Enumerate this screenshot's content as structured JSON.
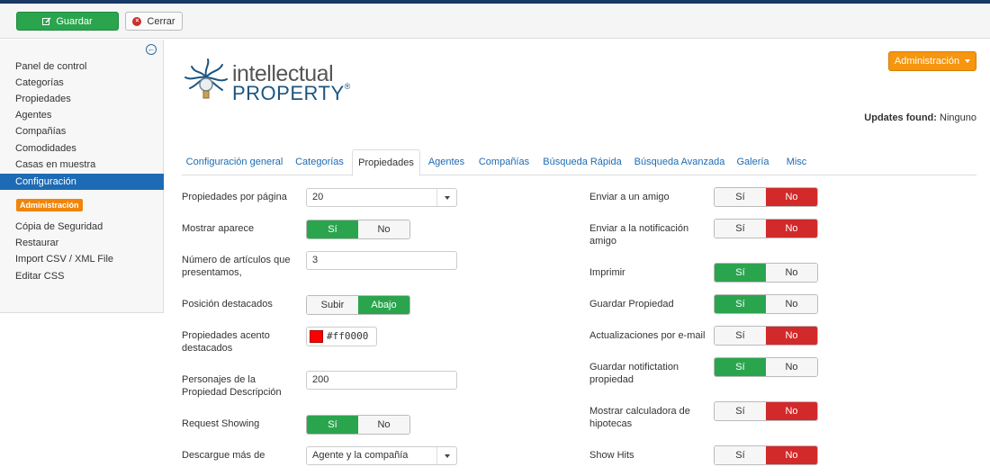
{
  "toolbar": {
    "save_label": "Guardar",
    "close_label": "Cerrar"
  },
  "sidebar": {
    "items": [
      {
        "label": "Panel de control"
      },
      {
        "label": "Categorías"
      },
      {
        "label": "Propiedades"
      },
      {
        "label": "Agentes"
      },
      {
        "label": "Compañías"
      },
      {
        "label": "Comodidades"
      },
      {
        "label": "Casas en muestra"
      },
      {
        "label": "Configuración"
      }
    ],
    "badge": "Administración",
    "tools": [
      {
        "label": "Cópia de Seguridad"
      },
      {
        "label": "Restaurar"
      },
      {
        "label": "Import CSV / XML File"
      },
      {
        "label": "Editar CSS"
      }
    ]
  },
  "logo": {
    "line1": "intellectual",
    "line2": "PROPERTY",
    "mark": "®"
  },
  "header": {
    "admin_button": "Administración",
    "updates_label": "Updates found:",
    "updates_value": "Ninguno"
  },
  "tabs": [
    {
      "label": "Configuración general"
    },
    {
      "label": "Categorías"
    },
    {
      "label": "Propiedades"
    },
    {
      "label": "Agentes"
    },
    {
      "label": "Compañías"
    },
    {
      "label": "Búsqueda Rápida"
    },
    {
      "label": "Búsqueda Avanzada"
    },
    {
      "label": "Galería"
    },
    {
      "label": "Misc"
    }
  ],
  "left_fields": {
    "per_page": {
      "label": "Propiedades por página",
      "value": "20"
    },
    "show_appears": {
      "label": "Mostrar aparece",
      "yes": "Sí",
      "no": "No",
      "selected": "yes"
    },
    "num_articles": {
      "label": "Número de artículos que presentamos,",
      "value": "3"
    },
    "featured_pos": {
      "label": "Posición destacados",
      "opt1": "Subir",
      "opt2": "Abajo",
      "selected": "opt2"
    },
    "accent": {
      "label": "Propiedades acento destacados",
      "value": "#ff0000"
    },
    "desc_chars": {
      "label": "Personajes de la Propiedad Descripción",
      "value": "200"
    },
    "request_showing": {
      "label": "Request Showing",
      "yes": "Sí",
      "no": "No",
      "selected": "yes"
    },
    "download_from": {
      "label": "Descargue más de",
      "value": "Agente y la compañía"
    }
  },
  "right_fields": {
    "send_friend": {
      "label": "Enviar a un amigo",
      "yes": "Sí",
      "no": "No",
      "selected": "no"
    },
    "send_notification": {
      "label": "Enviar a la notificación amigo",
      "yes": "Sí",
      "no": "No",
      "selected": "no"
    },
    "print": {
      "label": "Imprimir",
      "yes": "Sí",
      "no": "No",
      "selected": "yes"
    },
    "save_property": {
      "label": "Guardar Propiedad",
      "yes": "Sí",
      "no": "No",
      "selected": "yes"
    },
    "email_updates": {
      "label": "Actualizaciones por e-mail",
      "yes": "Sí",
      "no": "No",
      "selected": "no"
    },
    "save_notification": {
      "label": "Guardar notifictation propiedad",
      "yes": "Sí",
      "no": "No",
      "selected": "yes"
    },
    "mortgage_calc": {
      "label": "Mostrar calculadora de hipotecas",
      "yes": "Sí",
      "no": "No",
      "selected": "no"
    },
    "show_hits": {
      "label": "Show Hits",
      "yes": "Sí",
      "no": "No",
      "selected": "no"
    }
  },
  "colors": {
    "green": "#2aa54e",
    "red": "#d22a2a",
    "orange": "#f6950e",
    "active_blue": "#1d6bb4"
  }
}
